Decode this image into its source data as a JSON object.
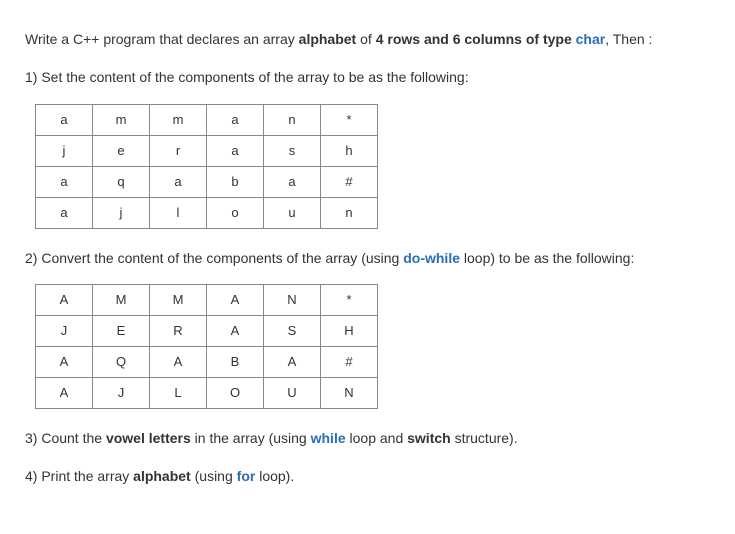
{
  "intro": {
    "prefix": "Write a C++ program that declares an array ",
    "arr_word": "alphabet",
    "mid": " of ",
    "dims": "4 rows and 6 columns of type ",
    "type_kw": "char",
    "suffix": ", Then :"
  },
  "q1": {
    "text": "1) Set the content of the components of the array to be as the following:"
  },
  "table1": {
    "rows": [
      [
        "a",
        "m",
        "m",
        "a",
        "n",
        "*"
      ],
      [
        "j",
        "e",
        "r",
        "a",
        "s",
        "h"
      ],
      [
        "a",
        "q",
        "a",
        "b",
        "a",
        "#"
      ],
      [
        "a",
        "j",
        "l",
        "o",
        "u",
        "n"
      ]
    ]
  },
  "q2": {
    "prefix": "2) Convert the content of the components of the array (using ",
    "loop_kw": "do-while",
    "mid": " loop) to be as the following:"
  },
  "table2": {
    "rows": [
      [
        "A",
        "M",
        "M",
        "A",
        "N",
        "*"
      ],
      [
        "J",
        "E",
        "R",
        "A",
        "S",
        "H"
      ],
      [
        "A",
        "Q",
        "A",
        "B",
        "A",
        "#"
      ],
      [
        "A",
        "J",
        "L",
        "O",
        "U",
        "N"
      ]
    ]
  },
  "q3": {
    "prefix": "3) Count the ",
    "vowels": "vowel letters",
    "mid1": " in the array (using ",
    "while_kw": "while",
    "mid2": " loop and ",
    "switch_kw": "switch",
    "suffix": " structure)."
  },
  "q4": {
    "prefix": "4) Print the array ",
    "arr_word": "alphabet",
    "mid": " (using ",
    "for_kw": "for",
    "suffix": " loop)."
  }
}
